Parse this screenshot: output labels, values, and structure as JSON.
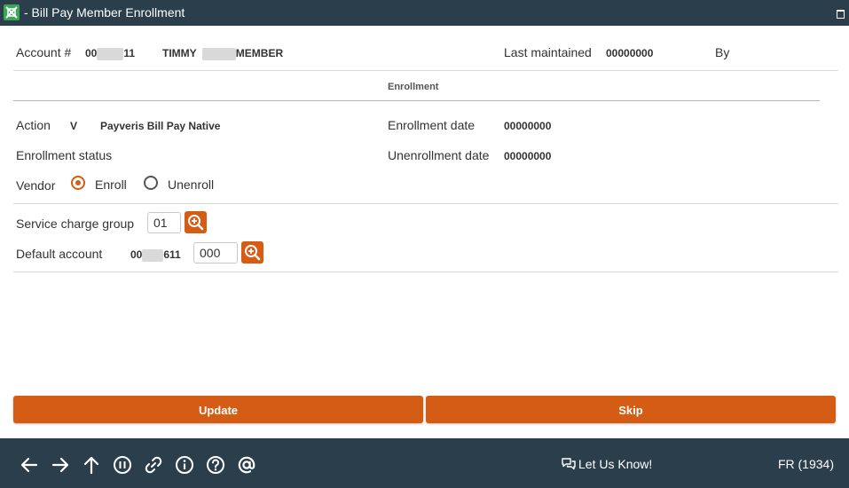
{
  "window": {
    "title": "- Bill Pay Member Enrollment"
  },
  "header": {
    "account_label": "Account #",
    "account_prefix": "00",
    "account_suffix": "11",
    "name_first": "TIMMY",
    "name_last_suffix": "MEMBER",
    "last_maintained_label": "Last maintained",
    "last_maintained_value": "00000000",
    "by_label": "By"
  },
  "enrollment": {
    "section_title": "Enrollment",
    "action_label": "Action",
    "action_code": "V",
    "action_description": "Payveris Bill Pay Native",
    "enrollment_date_label": "Enrollment date",
    "enrollment_date_value": "00000000",
    "status_label": "Enrollment status",
    "unenrollment_date_label": "Unenrollment date",
    "unenrollment_date_value": "00000000",
    "vendor_label": "Vendor",
    "vendor_options": [
      {
        "label": "Enroll",
        "selected": true
      },
      {
        "label": "Unenroll",
        "selected": false
      }
    ]
  },
  "service": {
    "service_charge_label": "Service charge group",
    "service_charge_value": "01",
    "default_account_label": "Default account",
    "default_account_prefix": "00",
    "default_account_suffix": "611",
    "default_account_input": "000"
  },
  "actions": {
    "update_label": "Update",
    "skip_label": "Skip"
  },
  "footer": {
    "feedback_label": "Let Us Know!",
    "locale_label": "FR (1934)",
    "icons": [
      "back-arrow-icon",
      "forward-arrow-icon",
      "up-arrow-icon",
      "pause-icon",
      "link-icon",
      "info-icon",
      "help-icon",
      "at-sign-icon"
    ]
  },
  "colors": {
    "accent": "#d45c14",
    "header_bg": "#2b3e4c"
  }
}
